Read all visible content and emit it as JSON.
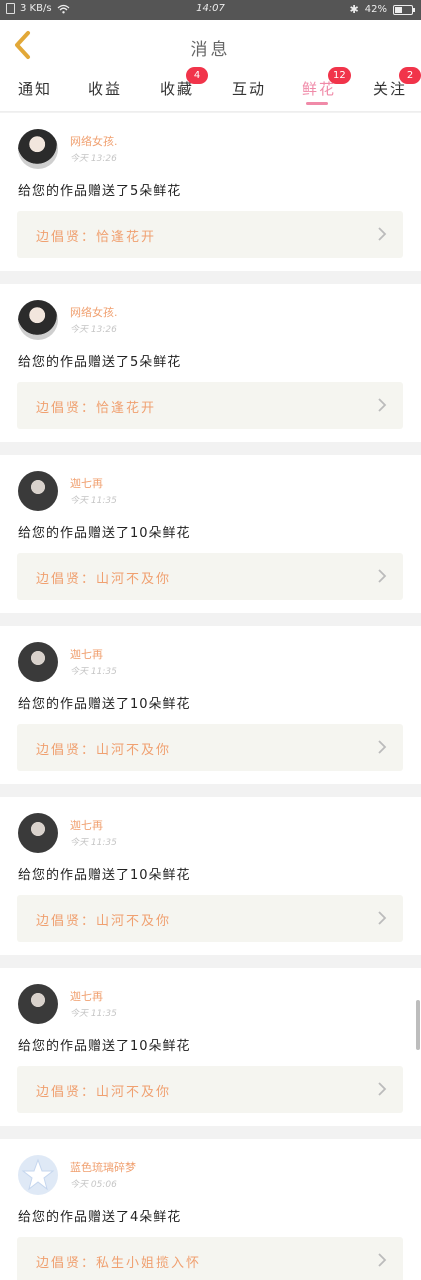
{
  "status_bar": {
    "net_speed": "3 KB/s",
    "time": "14:07",
    "battery": "42%",
    "battery_level": 0.42
  },
  "header": {
    "title": "消息",
    "back_icon": "chevron-left-icon"
  },
  "tabs": [
    {
      "label": "通知",
      "badge": "",
      "active": false
    },
    {
      "label": "收益",
      "badge": "",
      "active": false
    },
    {
      "label": "收藏",
      "badge": "4",
      "active": false
    },
    {
      "label": "互动",
      "badge": "",
      "active": false
    },
    {
      "label": "鲜花",
      "badge": "12",
      "active": true
    },
    {
      "label": "关注",
      "badge": "2",
      "active": false
    }
  ],
  "colors": {
    "accent_pink": "#f08aa8",
    "badge_red": "#f1344a",
    "name_orange": "#f0a070"
  },
  "messages": [
    {
      "name": "网络女孩.",
      "time": "今天 13:26",
      "text": "给您的作品赠送了5朵鲜花",
      "work": "边倡贤：恰逢花开",
      "avatar": "photo"
    },
    {
      "name": "网络女孩.",
      "time": "今天 13:26",
      "text": "给您的作品赠送了5朵鲜花",
      "work": "边倡贤：恰逢花开",
      "avatar": "photo"
    },
    {
      "name": "迦七再",
      "time": "今天 11:35",
      "text": "给您的作品赠送了10朵鲜花",
      "work": "边倡贤：山河不及你",
      "avatar": "dark"
    },
    {
      "name": "迦七再",
      "time": "今天 11:35",
      "text": "给您的作品赠送了10朵鲜花",
      "work": "边倡贤：山河不及你",
      "avatar": "dark"
    },
    {
      "name": "迦七再",
      "time": "今天 11:35",
      "text": "给您的作品赠送了10朵鲜花",
      "work": "边倡贤：山河不及你",
      "avatar": "dark"
    },
    {
      "name": "迦七再",
      "time": "今天 11:35",
      "text": "给您的作品赠送了10朵鲜花",
      "work": "边倡贤：山河不及你",
      "avatar": "dark"
    },
    {
      "name": "蓝色琉璃碎梦",
      "time": "今天 05:06",
      "text": "给您的作品赠送了4朵鲜花",
      "work": "边倡贤：私生小姐揽入怀",
      "avatar": "logo"
    }
  ]
}
